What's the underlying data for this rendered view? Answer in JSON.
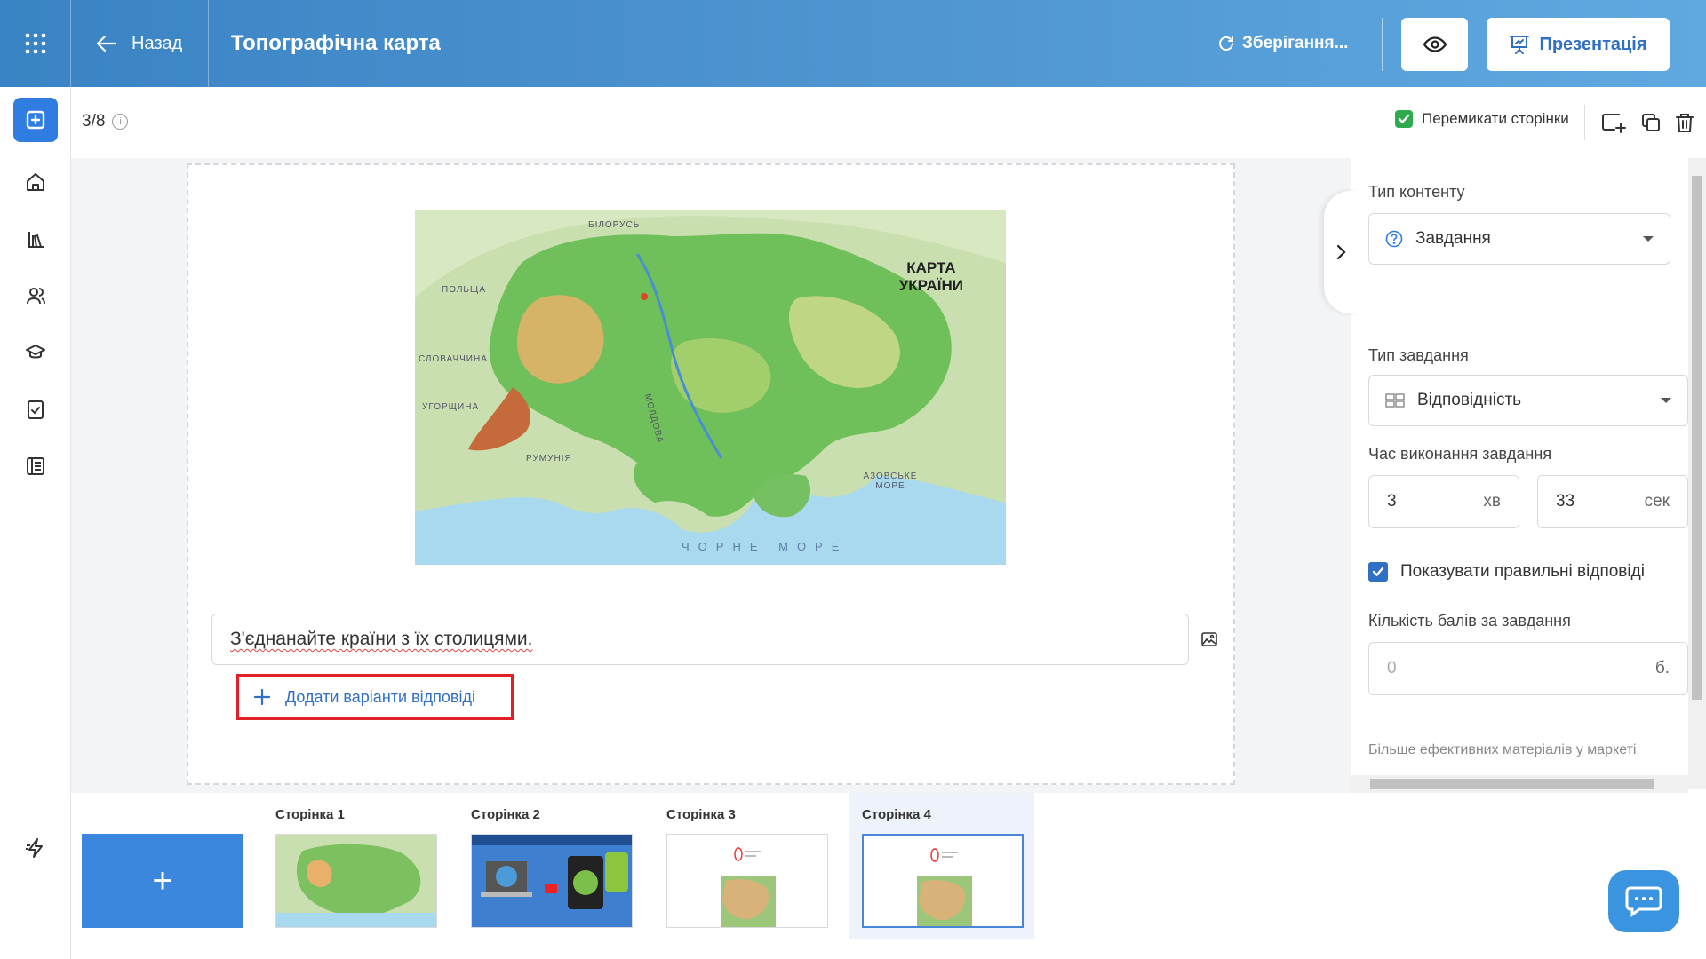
{
  "header": {
    "back_label": "Назад",
    "title": "Топографічна карта",
    "saving_label": "Зберігання...",
    "presentation_label": "Презентація"
  },
  "toolbar": {
    "page_counter": "3/8",
    "switch_pages_label": "Перемикати сторінки"
  },
  "slide": {
    "map": {
      "title_line1": "КАРТА",
      "title_line2": "УКРАЇНИ",
      "labels": {
        "belarus": "БІЛОРУСЬ",
        "poland": "ПОЛЬЩА",
        "slovakia": "СЛОВАЧЧИНА",
        "hungary": "УГОРЩИНА",
        "romania": "РУМУНІЯ",
        "moldova": "МОЛДОВА",
        "azov_sea": "АЗОВСЬКЕ МОРЕ",
        "black_sea": "ЧОРНЕ МОРЕ"
      }
    },
    "question_text": "З'єднанайте країни з їх столицями.",
    "add_answers_label": "Додати варіанти відповіді"
  },
  "panel": {
    "content_type_label": "Тип контенту",
    "content_type_value": "Завдання",
    "task_type_label": "Тип завдання",
    "task_type_value": "Відповідність",
    "time_label": "Час виконання завдання",
    "time_minutes": "3",
    "time_minutes_unit": "хв",
    "time_seconds": "33",
    "time_seconds_unit": "сек",
    "show_correct_label": "Показувати правильні відповіді",
    "show_correct_checked": true,
    "points_label": "Кількість балів за завдання",
    "points_placeholder": "0",
    "points_unit": "б.",
    "more_link": "Більше ефективних матеріалів у маркеті"
  },
  "pages": [
    {
      "label": "Сторінка 1"
    },
    {
      "label": "Сторінка 2"
    },
    {
      "label": "Сторінка 3"
    },
    {
      "label": "Сторінка 4",
      "active": true
    }
  ],
  "icons": {
    "apps": "grid-icon",
    "back": "arrow-left-icon",
    "saving": "refresh-icon",
    "preview": "eye-icon",
    "presentation": "presentation-icon",
    "sidebar": [
      "add-square-icon",
      "home-icon",
      "library-icon",
      "users-icon",
      "graduation-cap-icon",
      "checklist-icon",
      "journal-icon",
      "lightning-icon"
    ],
    "chat": "chat-icon"
  },
  "colors": {
    "header_gradient_start": "#3a83c4",
    "header_gradient_end": "#5fa8e0",
    "accent_blue": "#2f7de1",
    "highlight_red": "#e0212a",
    "check_green": "#2eaa4f"
  }
}
